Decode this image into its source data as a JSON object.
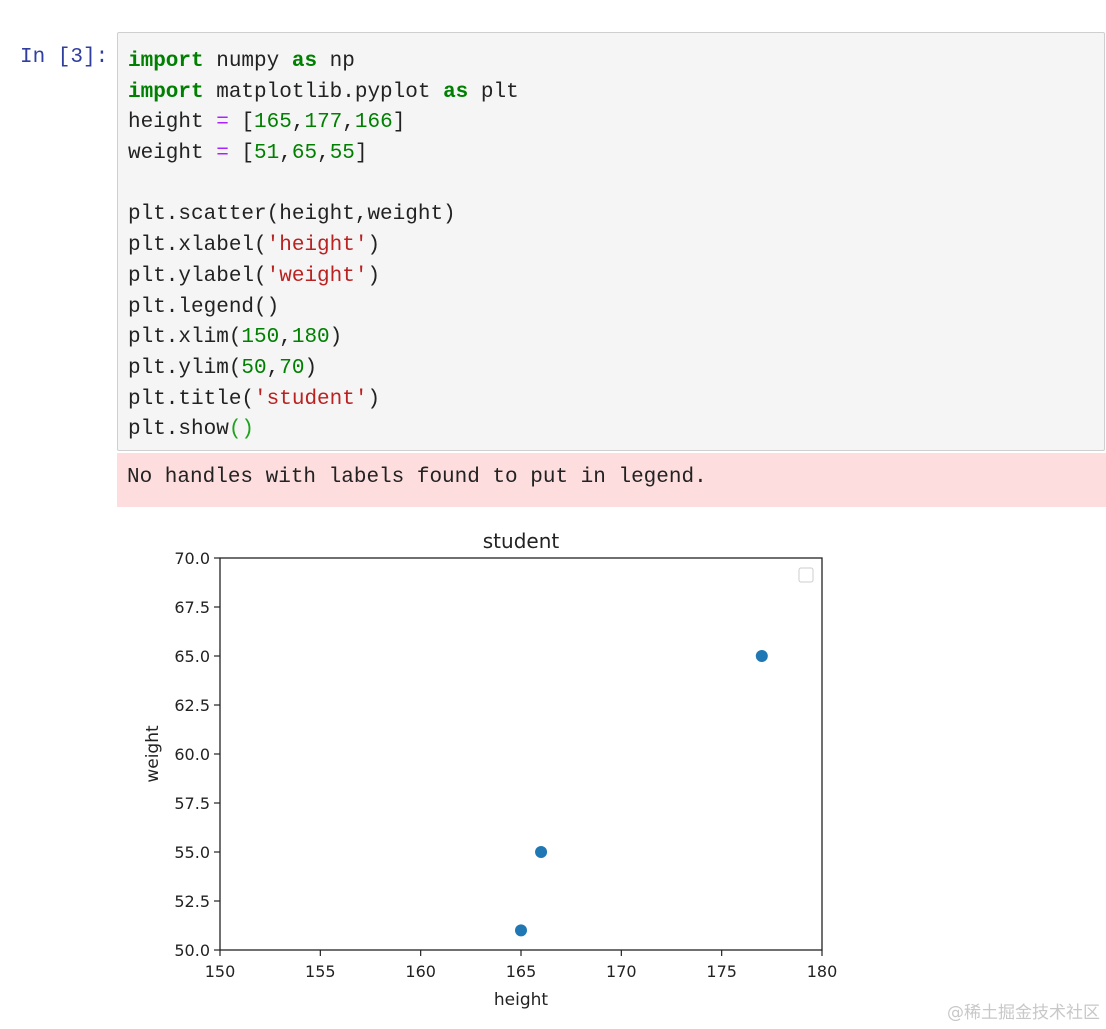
{
  "cell": {
    "prompt": "In [3]:",
    "lines": [
      [
        {
          "t": "import",
          "c": "kw"
        },
        {
          "t": " numpy "
        },
        {
          "t": "as",
          "c": "kw"
        },
        {
          "t": " np"
        }
      ],
      [
        {
          "t": "import",
          "c": "kw"
        },
        {
          "t": " matplotlib.pyplot "
        },
        {
          "t": "as",
          "c": "kw"
        },
        {
          "t": " plt"
        }
      ],
      [
        {
          "t": "height "
        },
        {
          "t": "=",
          "c": "op"
        },
        {
          "t": " ["
        },
        {
          "t": "165",
          "c": "num"
        },
        {
          "t": ","
        },
        {
          "t": "177",
          "c": "num"
        },
        {
          "t": ","
        },
        {
          "t": "166",
          "c": "num"
        },
        {
          "t": "]"
        }
      ],
      [
        {
          "t": "weight "
        },
        {
          "t": "=",
          "c": "op"
        },
        {
          "t": " ["
        },
        {
          "t": "51",
          "c": "num"
        },
        {
          "t": ","
        },
        {
          "t": "65",
          "c": "num"
        },
        {
          "t": ","
        },
        {
          "t": "55",
          "c": "num"
        },
        {
          "t": "]"
        }
      ],
      [],
      [
        {
          "t": "plt.scatter(height,weight)"
        }
      ],
      [
        {
          "t": "plt.xlabel("
        },
        {
          "t": "'height'",
          "c": "str"
        },
        {
          "t": ")"
        }
      ],
      [
        {
          "t": "plt.ylabel("
        },
        {
          "t": "'weight'",
          "c": "str"
        },
        {
          "t": ")"
        }
      ],
      [
        {
          "t": "plt.legend()"
        }
      ],
      [
        {
          "t": "plt.xlim("
        },
        {
          "t": "150",
          "c": "num"
        },
        {
          "t": ","
        },
        {
          "t": "180",
          "c": "num"
        },
        {
          "t": ")"
        }
      ],
      [
        {
          "t": "plt.ylim("
        },
        {
          "t": "50",
          "c": "num"
        },
        {
          "t": ","
        },
        {
          "t": "70",
          "c": "num"
        },
        {
          "t": ")"
        }
      ],
      [
        {
          "t": "plt.title("
        },
        {
          "t": "'student'",
          "c": "str"
        },
        {
          "t": ")"
        }
      ],
      [
        {
          "t": "plt.show"
        },
        {
          "t": "()",
          "c": "paren-hl"
        }
      ]
    ]
  },
  "stderr_text": "No handles with labels found to put in legend.",
  "chart_data": {
    "type": "scatter",
    "title": "student",
    "xlabel": "height",
    "ylabel": "weight",
    "x": [
      165,
      177,
      166
    ],
    "y": [
      51,
      65,
      55
    ],
    "xlim": [
      150,
      180
    ],
    "ylim": [
      50,
      70
    ],
    "xticks": [
      "150",
      "155",
      "160",
      "165",
      "170",
      "175",
      "180"
    ],
    "yticks": [
      "50.0",
      "52.5",
      "55.0",
      "57.5",
      "60.0",
      "62.5",
      "65.0",
      "67.5",
      "70.0"
    ],
    "marker_color": "#1f77b4",
    "legend": "empty",
    "legend_placement": "top-right",
    "grid": false
  },
  "watermark": "@稀土掘金技术社区"
}
